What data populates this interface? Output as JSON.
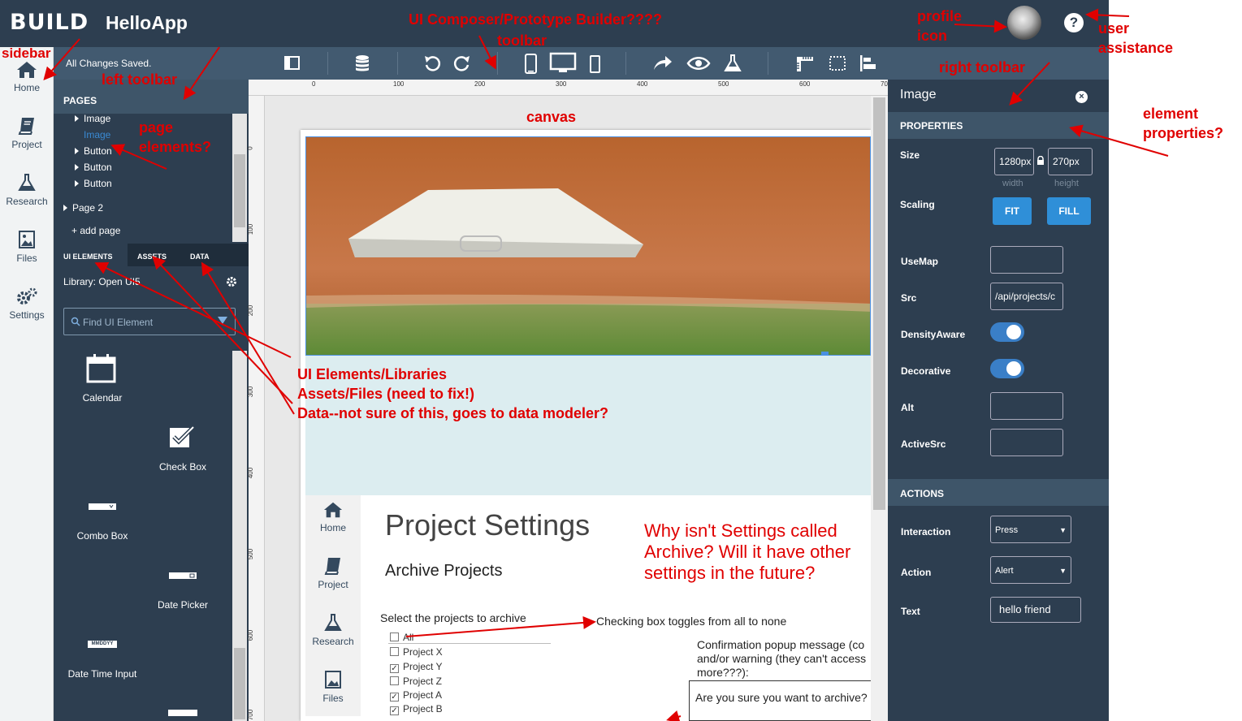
{
  "app": {
    "logo": "BUILD",
    "name": "HelloApp"
  },
  "sidebar": {
    "items": [
      {
        "label": "Home",
        "icon": "home-icon"
      },
      {
        "label": "Project",
        "icon": "book-icon"
      },
      {
        "label": "Research",
        "icon": "flask-icon"
      },
      {
        "label": "Files",
        "icon": "image-file-icon"
      },
      {
        "label": "Settings",
        "icon": "gears-icon"
      }
    ]
  },
  "toolbar": {
    "status": "All Changes Saved."
  },
  "left_panel": {
    "pages_header": "PAGES",
    "tree": [
      "Image",
      "Image",
      "Button",
      "Button",
      "Button"
    ],
    "page2": "Page 2",
    "add_page": "+ add page",
    "tabs": [
      "UI ELEMENTS",
      "ASSETS",
      "DATA"
    ],
    "library": "Library: Open UI5",
    "search_placeholder": "Find UI Element",
    "elements": [
      "Calendar",
      "Check Box",
      "Combo Box",
      "Date Picker",
      "Date Time Input"
    ],
    "dt_icon_text": "MMDDYY"
  },
  "ruler": {
    "h": [
      "0",
      "100",
      "200",
      "300",
      "400",
      "500",
      "600",
      "70"
    ],
    "v": [
      "0",
      "100",
      "200",
      "300",
      "400",
      "500",
      "600",
      "700"
    ]
  },
  "canvas": {
    "inner_sidebar": [
      "Home",
      "Project",
      "Research",
      "Files"
    ],
    "title": "Project Settings",
    "subtitle": "Archive Projects",
    "select_label": "Select the projects to archive",
    "projects": [
      {
        "name": "All",
        "checked": false
      },
      {
        "name": "Project X",
        "checked": false
      },
      {
        "name": "Project Y",
        "checked": true
      },
      {
        "name": "Project Z",
        "checked": false
      },
      {
        "name": "Project A",
        "checked": true
      },
      {
        "name": "Project B",
        "checked": true
      }
    ],
    "confirm_line1": "Confirmation popup message (co",
    "confirm_line2": "and/or warning (they can't access",
    "confirm_line3": "more???):",
    "confirm_box": "Are you sure you want to archive?"
  },
  "right_panel": {
    "title": "Image",
    "properties_header": "PROPERTIES",
    "size_label": "Size",
    "width_value": "1280px",
    "height_value": "270px",
    "width_caption": "width",
    "height_caption": "height",
    "scaling_label": "Scaling",
    "fit": "FIT",
    "fill": "FILL",
    "usemap_label": "UseMap",
    "src_label": "Src",
    "src_value": "/api/projects/c",
    "density_label": "DensityAware",
    "decorative_label": "Decorative",
    "alt_label": "Alt",
    "activesrc_label": "ActiveSrc",
    "actions_header": "ACTIONS",
    "interaction_label": "Interaction",
    "interaction_value": "Press",
    "action_label": "Action",
    "action_value": "Alert",
    "text_label": "Text",
    "text_value": "hello friend"
  },
  "annotations": {
    "sidebar": "sidebar",
    "composer": "UI Composer/Prototype Builder????",
    "toolbar": "toolbar",
    "profile1": "profile",
    "profile2": "icon",
    "user1": "user",
    "user2": "assistance",
    "left_toolbar": "left toolbar",
    "right_toolbar": "right toolbar",
    "page1": "page",
    "page2": "elements?",
    "canvas": "canvas",
    "element1": "element",
    "element2": "properties?",
    "ui_libs": "UI Elements/Libraries",
    "assets": "Assets/Files (need to fix!)",
    "data": "Data--not sure of this, goes to data modeler?",
    "why1": "Why isn't Settings called",
    "why2": "Archive? Will it have other",
    "why3": "settings in the future?",
    "checking": "Checking box toggles from all to none"
  },
  "colors": {
    "annotation": "#e00000",
    "dark": "#2d3e50",
    "accent": "#2f8fd8"
  }
}
